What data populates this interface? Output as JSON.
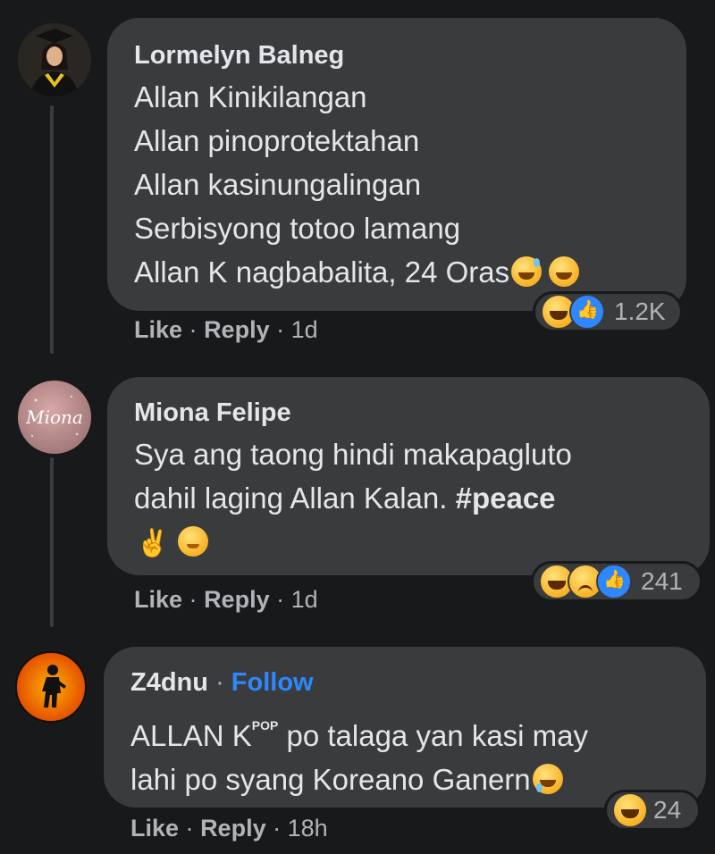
{
  "comments": [
    {
      "author": "Lormelyn Balneg",
      "lines": [
        "Allan Kinikilangan",
        "Allan pinoprotektahan",
        "Allan kasinungalingan",
        "Serbisyong totoo lamang",
        "Allan K nagbabalita, 24 Oras"
      ],
      "like_label": "Like",
      "reply_label": "Reply",
      "separator": "·",
      "time": "1d",
      "reaction_count": "1.2K",
      "reactions": [
        "haha-icon",
        "like-icon"
      ]
    },
    {
      "author": "Miona Felipe",
      "lines": [
        "Sya ang taong hindi makapagluto",
        "dahil laging Allan Kalan."
      ],
      "hashtag": "#peace",
      "like_label": "Like",
      "reply_label": "Reply",
      "separator": "·",
      "time": "1d",
      "reaction_count": "241",
      "reactions": [
        "haha-icon",
        "sad-icon",
        "like-icon"
      ]
    },
    {
      "author": "Z4dnu",
      "follow_label": "Follow",
      "line1_prefix": "ALLAN K",
      "line1_sup": "POP",
      "line1_suffix": " po talaga yan kasi may",
      "line2": "lahi po syang Koreano Ganern",
      "like_label": "Like",
      "reply_label": "Reply",
      "separator": "·",
      "time": "18h",
      "reaction_count": "24",
      "reactions": [
        "haha-icon"
      ]
    }
  ],
  "colors": {
    "background": "#18191a",
    "bubble": "#3a3b3c",
    "link": "#2d88ff",
    "secondary_text": "#b0b3b8"
  }
}
